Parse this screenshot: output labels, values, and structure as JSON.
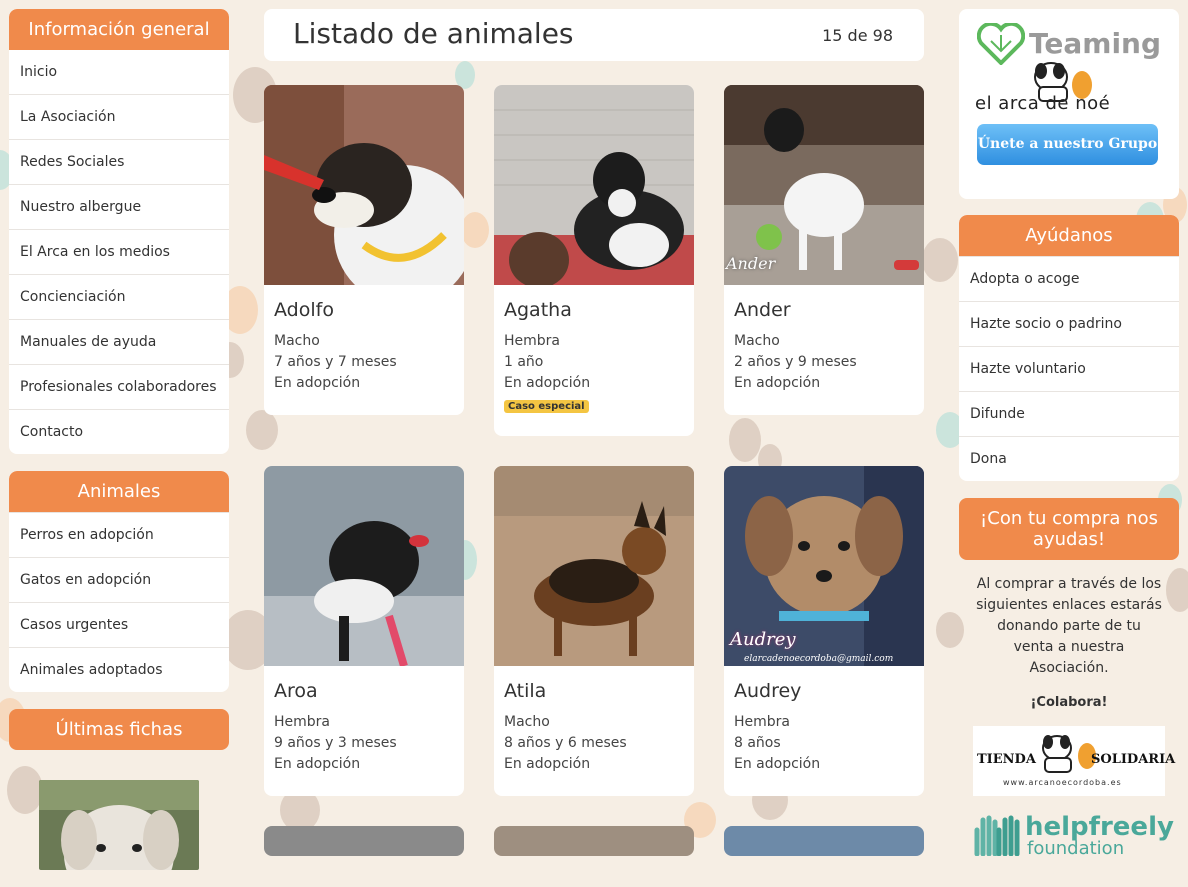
{
  "general": {
    "heading": "Información general",
    "items": [
      "Inicio",
      "La Asociación",
      "Redes Sociales",
      "Nuestro albergue",
      "El Arca en los medios",
      "Concienciación",
      "Manuales de ayuda",
      "Profesionales colaboradores",
      "Contacto"
    ]
  },
  "animals_menu": {
    "heading": "Animales",
    "items": [
      "Perros en adopción",
      "Gatos en adopción",
      "Casos urgentes",
      "Animales adoptados"
    ]
  },
  "recent": {
    "heading": "Últimas fichas"
  },
  "main": {
    "title": "Listado de animales",
    "count": "15 de 98",
    "cards": [
      {
        "name": "Adolfo",
        "sex": "Macho",
        "age": "7 años y 7 meses",
        "status": "En adopción"
      },
      {
        "name": "Agatha",
        "sex": "Hembra",
        "age": "1 año",
        "status": "En adopción",
        "badge": "Caso especial"
      },
      {
        "name": "Ander",
        "sex": "Macho",
        "age": "2 años y 9 meses",
        "status": "En adopción",
        "watermark": "Ander"
      },
      {
        "name": "Aroa",
        "sex": "Hembra",
        "age": "9 años y 3 meses",
        "status": "En adopción"
      },
      {
        "name": "Atila",
        "sex": "Macho",
        "age": "8 años y 6 meses",
        "status": "En adopción"
      },
      {
        "name": "Audrey",
        "sex": "Hembra",
        "age": "8 años",
        "status": "En adopción",
        "watermark": "Audrey",
        "watermark_email": "elarcadenoecordoba@gmail.com"
      }
    ]
  },
  "teaming": {
    "logo_text": "Teaming",
    "org_text": "el arca de noé",
    "button": "Únete a nuestro Grupo"
  },
  "help": {
    "heading": "Ayúdanos",
    "items": [
      "Adopta o acoge",
      "Hazte socio o padrino",
      "Hazte voluntario",
      "Difunde",
      "Dona"
    ]
  },
  "shop": {
    "heading": "¡Con tu compra nos ayudas!",
    "text": "Al comprar a través de los siguientes enlaces estarás donando parte de tu venta a nuestra Asociación.",
    "colabora": "¡Colabora!",
    "tienda_left": "TIENDA",
    "tienda_right": "SOLIDARIA",
    "tienda_url": "www.arcanoecordoba.es",
    "helpfreely": "helpfreely",
    "foundation": "foundation"
  },
  "colors": {
    "accent": "#f08a4b",
    "badge": "#f4c542",
    "background": "#f6eee4"
  }
}
